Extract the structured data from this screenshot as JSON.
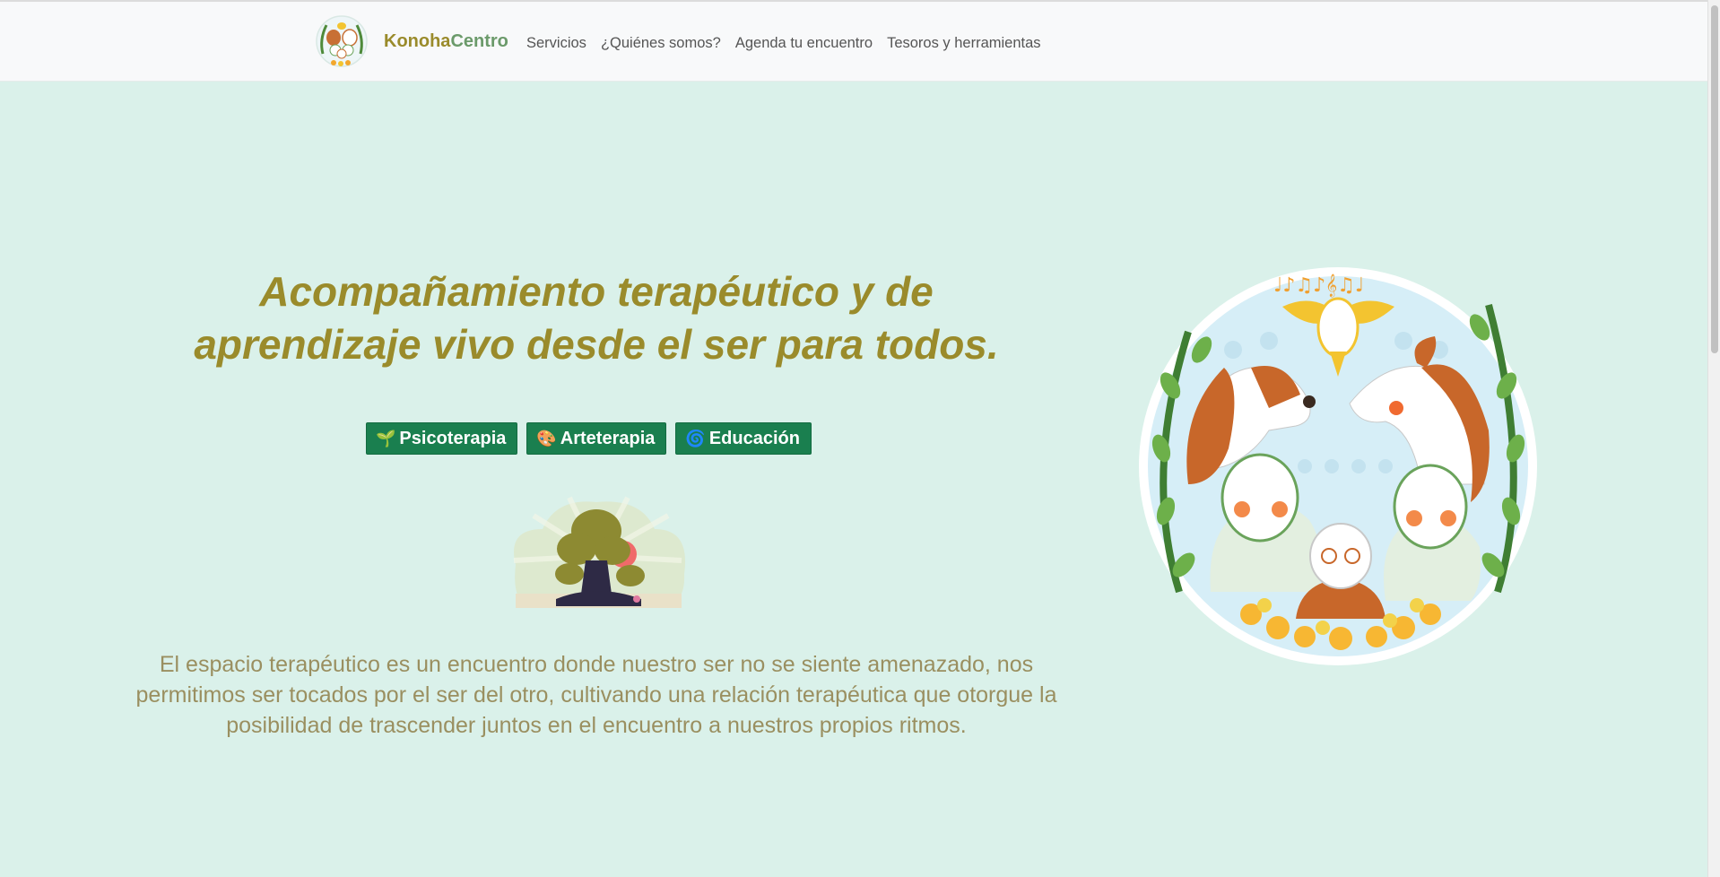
{
  "brand": {
    "part1": "Konoha",
    "part2": "Centro"
  },
  "nav": {
    "items": [
      "Servicios",
      "¿Quiénes somos?",
      "Agenda tu encuentro",
      "Tesoros y herramientas"
    ]
  },
  "hero": {
    "title_line1": "Acompañamiento terapéutico y de",
    "title_line2": "aprendizaje vivo desde el ser para todos.",
    "chips": [
      {
        "icon": "🌱",
        "label": "Psicoterapia"
      },
      {
        "icon": "🎨",
        "label": "Arteterapia"
      },
      {
        "icon": "🌀",
        "label": "Educación"
      }
    ],
    "description": "El espacio terapéutico es un encuentro donde nuestro ser no se siente amenazado, nos permitimos ser tocados por el ser del otro, cultivando una relación terapéutica que otorgue la posibilidad de trascender juntos en el encuentro a nuestros propios ritmos."
  },
  "colors": {
    "background": "#daf1ea",
    "navbar": "#f8f9fa",
    "accent_olive": "#9a8b2b",
    "accent_green": "#6b9a6a",
    "chip_green": "#1a7f4f",
    "text_muted": "#9a8f60"
  }
}
